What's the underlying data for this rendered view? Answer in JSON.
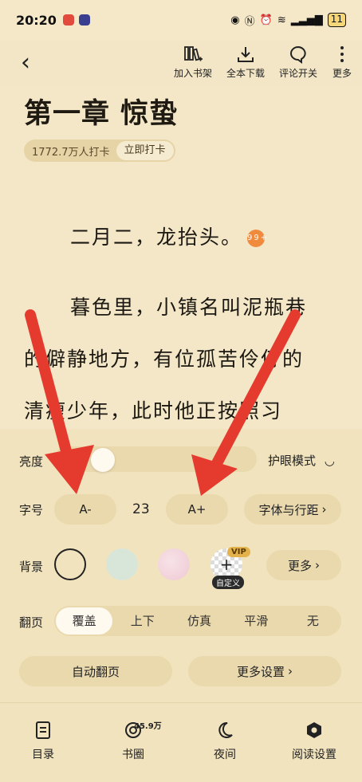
{
  "status": {
    "time": "20:20",
    "battery": "11"
  },
  "toolbar": {
    "add_shelf": "加入书架",
    "download": "全本下载",
    "comment_toggle": "评论开关",
    "more": "更多"
  },
  "reader": {
    "chapter_title": "第一章 惊蛰",
    "checkin_count": "1772.7万人打卡",
    "checkin_button": "立即打卡",
    "para1": "二月二，龙抬头。",
    "para1_badge": "99+",
    "para2_line1": "暮色里，小镇名叫泥瓶巷",
    "para2_line2": "的僻静地方，有位孤苦伶仃的",
    "para2_line3": "清瘦少年，此时他正按照习"
  },
  "settings": {
    "brightness_label": "亮度",
    "brightness_level": 0.2,
    "eye_mode_label": "护眼模式",
    "font_size_label": "字号",
    "font_decrease": "A-",
    "font_size_value": "23",
    "font_increase": "A+",
    "font_spacing": "字体与行距",
    "background_label": "背景",
    "bg_vip": "VIP",
    "bg_custom": "自定义",
    "bg_more": "更多",
    "page_turn_label": "翻页",
    "page_turn_options": [
      "覆盖",
      "上下",
      "仿真",
      "平滑",
      "无"
    ],
    "page_turn_selected": "覆盖",
    "auto_turn": "自动翻页",
    "more_settings": "更多设置"
  },
  "colors": {
    "background": "#f2e6c6",
    "panel": "#f1e3be",
    "arrow": "#e53b2f"
  },
  "bottom_nav": {
    "catalog": "目录",
    "circle": "书圈",
    "circle_badge": "45.9万",
    "night": "夜间",
    "reading_settings": "阅读设置"
  }
}
